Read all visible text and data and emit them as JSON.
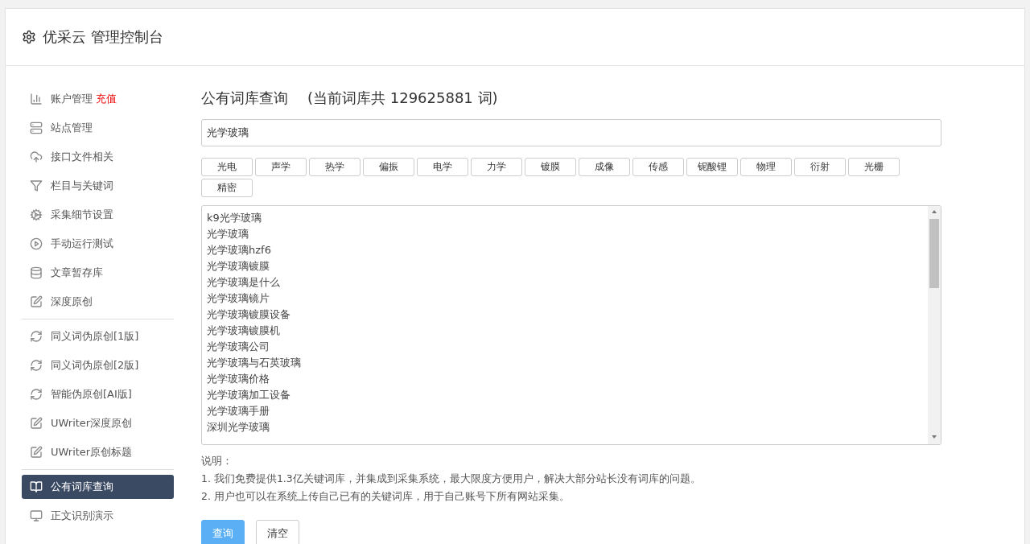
{
  "header": {
    "title": "优采云 管理控制台"
  },
  "sidebar": {
    "groups": [
      {
        "items": [
          {
            "kind": "chart",
            "label": "账户管理",
            "badge": "充值",
            "selected": false
          },
          {
            "kind": "server",
            "label": "站点管理",
            "selected": false
          },
          {
            "kind": "cloud",
            "label": "接口文件相关",
            "selected": false
          },
          {
            "kind": "filter",
            "label": "栏目与关键词",
            "selected": false
          },
          {
            "kind": "gears",
            "label": "采集细节设置",
            "selected": false
          },
          {
            "kind": "play",
            "label": "手动运行测试",
            "selected": false
          },
          {
            "kind": "database",
            "label": "文章暂存库",
            "selected": false
          },
          {
            "kind": "edit",
            "label": "深度原创",
            "selected": false
          }
        ]
      },
      {
        "items": [
          {
            "kind": "refresh",
            "label": "同义词伪原创[1版]",
            "selected": false
          },
          {
            "kind": "refresh",
            "label": "同义词伪原创[2版]",
            "selected": false
          },
          {
            "kind": "refresh",
            "label": "智能伪原创[AI版]",
            "selected": false
          },
          {
            "kind": "edit",
            "label": "UWriter深度原创",
            "selected": false
          },
          {
            "kind": "edit",
            "label": "UWriter原创标题",
            "selected": false
          }
        ]
      },
      {
        "items": [
          {
            "kind": "book",
            "label": "公有词库查询",
            "selected": true
          },
          {
            "kind": "monitor",
            "label": "正文识别演示",
            "selected": false
          }
        ]
      }
    ]
  },
  "main": {
    "title": "公有词库查询",
    "count_note": "(当前词库共 129625881 词)",
    "search": {
      "value": "光学玻璃"
    },
    "tags": [
      "光电",
      "声学",
      "热学",
      "偏振",
      "电学",
      "力学",
      "镀膜",
      "成像",
      "传感",
      "铌酸锂",
      "物理",
      "衍射",
      "光栅",
      "精密"
    ],
    "results": [
      "k9光学玻璃",
      "光学玻璃",
      "光学玻璃hzf6",
      "光学玻璃镀膜",
      "光学玻璃是什么",
      "光学玻璃镜片",
      "光学玻璃镀膜设备",
      "光学玻璃镀膜机",
      "光学玻璃公司",
      "光学玻璃与石英玻璃",
      "光学玻璃价格",
      "光学玻璃加工设备",
      "光学玻璃手册",
      "深圳光学玻璃"
    ],
    "notes_title": "说明：",
    "notes": [
      "1. 我们免费提供1.3亿关键词库，并集成到采集系统，最大限度方便用户，解决大部分站长没有词库的问题。",
      "2. 用户也可以在系统上传自己已有的关键词库，用于自己账号下所有网站采集。"
    ],
    "buttons": [
      {
        "kind": "primary",
        "label": "查询"
      },
      {
        "kind": "default",
        "label": "清空"
      }
    ]
  }
}
